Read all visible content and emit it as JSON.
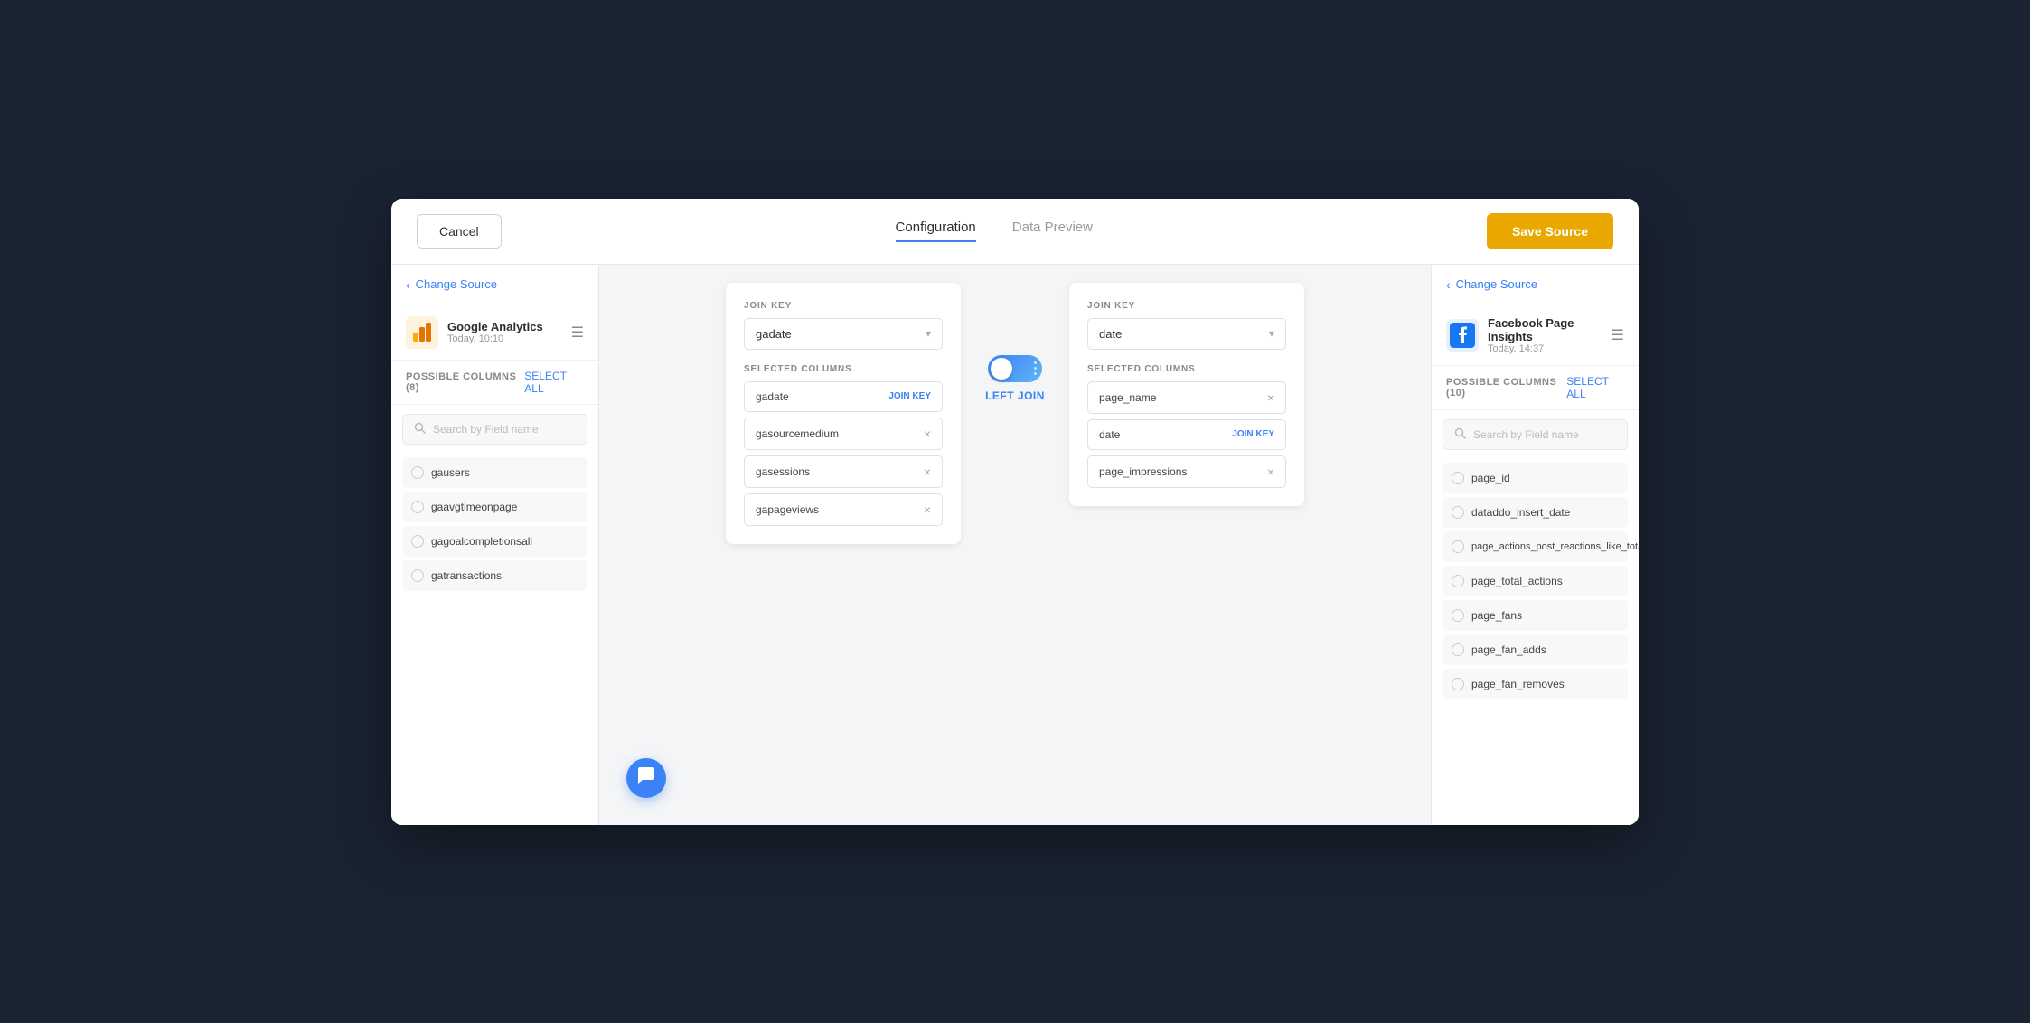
{
  "header": {
    "cancel_label": "Cancel",
    "save_label": "Save Source",
    "tabs": [
      {
        "id": "configuration",
        "label": "Configuration",
        "active": true
      },
      {
        "id": "data_preview",
        "label": "Data Preview",
        "active": false
      }
    ]
  },
  "left_panel": {
    "change_source_label": "Change Source",
    "source_name": "Google Analytics",
    "source_time": "Today, 10:10",
    "columns_count_label": "POSSIBLE COLUMNS (8)",
    "select_all_label": "SELECT ALL",
    "search_placeholder": "Search by Field name",
    "columns": [
      {
        "name": "gausers"
      },
      {
        "name": "gaavgtimeonpage"
      },
      {
        "name": "gagoalcompletionsall"
      },
      {
        "name": "gatransactions"
      }
    ]
  },
  "right_panel": {
    "change_source_label": "Change Source",
    "source_name": "Facebook Page Insights",
    "source_time": "Today, 14:37",
    "columns_count_label": "POSSIBLE COLUMNS (10)",
    "select_all_label": "SELECT ALL",
    "search_placeholder": "Search by Field name",
    "columns": [
      {
        "name": "page_id"
      },
      {
        "name": "dataddo_insert_date"
      },
      {
        "name": "page_actions_post_reactions_like_total"
      },
      {
        "name": "page_total_actions"
      },
      {
        "name": "page_fans"
      },
      {
        "name": "page_fan_adds"
      },
      {
        "name": "page_fan_removes"
      }
    ]
  },
  "left_join_panel": {
    "join_key_label": "JOIN KEY",
    "join_key_value": "gadate",
    "selected_columns_label": "SELECTED COLUMNS",
    "selected_columns": [
      {
        "name": "gadate",
        "badge": "JOIN KEY"
      },
      {
        "name": "gasourcemedium",
        "badge": null
      },
      {
        "name": "gasessions",
        "badge": null
      },
      {
        "name": "gapageviews",
        "badge": null
      }
    ]
  },
  "right_join_panel": {
    "join_key_label": "JOIN KEY",
    "join_key_value": "date",
    "selected_columns_label": "SELECTED COLUMNS",
    "selected_columns": [
      {
        "name": "page_name",
        "badge": null
      },
      {
        "name": "date",
        "badge": "JOIN KEY"
      },
      {
        "name": "page_impressions",
        "badge": null
      }
    ]
  },
  "join_connector": {
    "label": "LEFT JOIN"
  },
  "icons": {
    "chevron_left": "‹",
    "dropdown_arrow": "▾",
    "remove": "×",
    "search": "○",
    "document": "☰",
    "chat": "💬"
  }
}
